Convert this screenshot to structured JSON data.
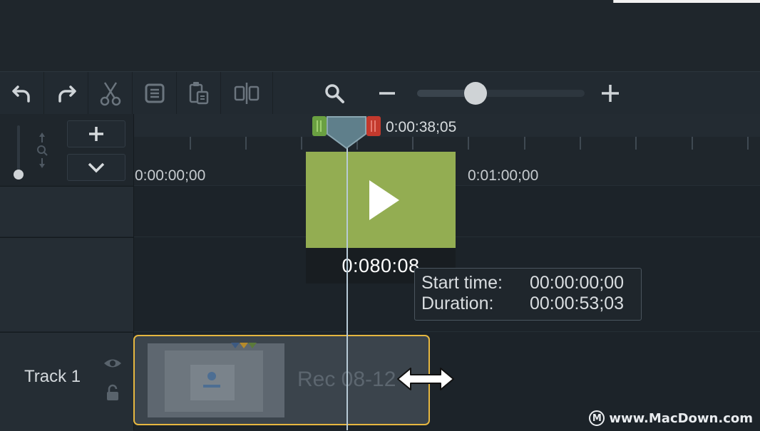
{
  "playhead": {
    "time": "0:00:38;05"
  },
  "ruler": {
    "labels": [
      "0:00:00;00",
      "0:01:00;00"
    ]
  },
  "preview": {
    "time": "0:080:08"
  },
  "clip_info": {
    "start_label": "Start time:",
    "start_value": "00:00:00;00",
    "duration_label": "Duration:",
    "duration_value": "00:00:53;03"
  },
  "tracks": [
    {
      "label": "Track 1",
      "clip_name": "Rec 08-12"
    }
  ],
  "zoom": {
    "level": 0.35
  },
  "watermark": {
    "text": "www.MacDown.com",
    "logo_letter": "M"
  },
  "icons": [
    "undo-icon",
    "redo-icon",
    "cut-icon",
    "copy-icon",
    "paste-icon",
    "split-icon",
    "search-icon",
    "zoom-out-icon",
    "zoom-in-icon",
    "add-icon",
    "chevron-down-icon",
    "eye-icon",
    "lock-icon",
    "play-icon",
    "resize-arrow-icon"
  ],
  "colors": {
    "clip_border": "#e6b740",
    "preview": "#93ad52",
    "in_marker": "#6aa041",
    "out_marker": "#c3392d"
  }
}
